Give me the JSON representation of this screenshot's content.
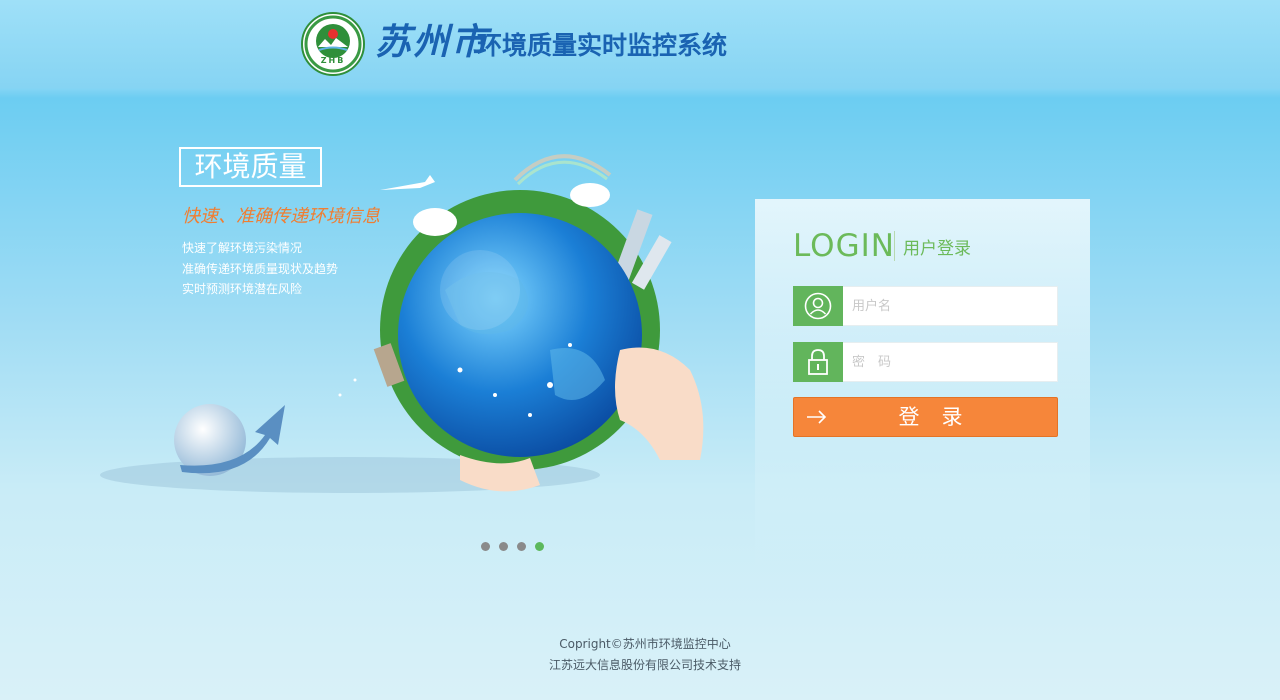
{
  "header": {
    "emblem_text": "ZHB",
    "city_name": "苏州市",
    "system_title": "环境质量实时监控系统"
  },
  "hero": {
    "box_title": "环境质量",
    "slogan": "快速、准确传递环境信息",
    "lines": [
      "快速了解环境污染情况",
      "准确传递环境质量现状及趋势",
      "实时预测环境潜在风险"
    ]
  },
  "carousel": {
    "count": 4,
    "active_index": 3
  },
  "login": {
    "title": "LOGIN",
    "subtitle": "用户登录",
    "username_placeholder": "用户名",
    "password_placeholder": "密　码",
    "button_label": "登录"
  },
  "footer": {
    "copyright": "Copright©苏州市环境监控中心",
    "support": "江苏远大信息股份有限公司技术支持"
  },
  "colors": {
    "accent_green": "#62b55c",
    "button_orange": "#f6863a",
    "title_blue": "#1a63b2",
    "slogan_orange": "#f07e32"
  }
}
